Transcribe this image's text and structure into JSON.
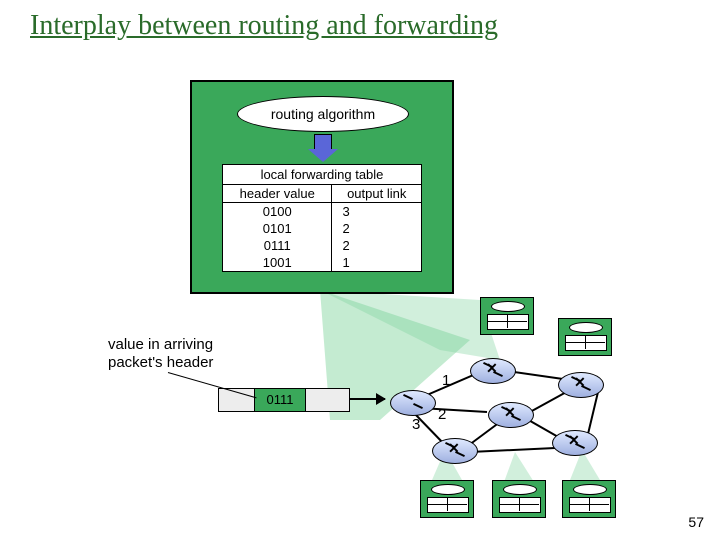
{
  "title": "Interplay between routing and forwarding",
  "routing_alg_label": "routing algorithm",
  "fw_table": {
    "caption": "local forwarding table",
    "col_header_left": "header value",
    "col_header_right": "output link",
    "rows": [
      {
        "hv": "0100",
        "ol": "3"
      },
      {
        "hv": "0101",
        "ol": "2"
      },
      {
        "hv": "0111",
        "ol": "2"
      },
      {
        "hv": "1001",
        "ol": "1"
      }
    ]
  },
  "arriving_label_line1": "value in arriving",
  "arriving_label_line2": "packet's header",
  "packet_header_value": "0111",
  "port_labels": {
    "p1": "1",
    "p2": "2",
    "p3": "3"
  },
  "page_number": "57"
}
